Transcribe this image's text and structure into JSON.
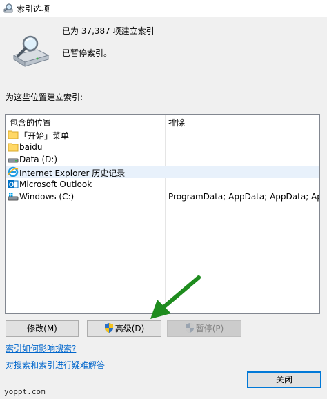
{
  "window": {
    "title": "索引选项"
  },
  "summary": {
    "indexed_count": "已为 37,387 项建立索引",
    "status": "已暂停索引。"
  },
  "section_label": "为这些位置建立索引:",
  "list": {
    "columns": {
      "included": "包含的位置",
      "excluded": "排除"
    },
    "rows": [
      {
        "location": "「开始」菜单",
        "excluded": "",
        "icon": "folder-icon"
      },
      {
        "location": "baidu",
        "excluded": "",
        "icon": "folder-icon"
      },
      {
        "location": "Data (D:)",
        "excluded": "",
        "icon": "drive-icon"
      },
      {
        "location": "Internet Explorer 历史记录",
        "excluded": "",
        "icon": "internet-explorer-icon"
      },
      {
        "location": "Microsoft Outlook",
        "excluded": "",
        "icon": "outlook-icon"
      },
      {
        "location": "Windows (C:)",
        "excluded": "ProgramData; AppData; AppData; AppDat...",
        "icon": "windows-drive-icon"
      }
    ]
  },
  "buttons": {
    "modify": "修改(M)",
    "advanced": "高级(D)",
    "pause": "暂停(P)",
    "close": "关闭"
  },
  "links": {
    "how_index_affects_search": "索引如何影响搜索?",
    "troubleshoot": "对搜索和索引进行疑难解答"
  },
  "watermark": "yoppt.com",
  "colors": {
    "accent": "#0078d7",
    "link": "#0066cc",
    "annotation_arrow": "#1e8c1e"
  }
}
